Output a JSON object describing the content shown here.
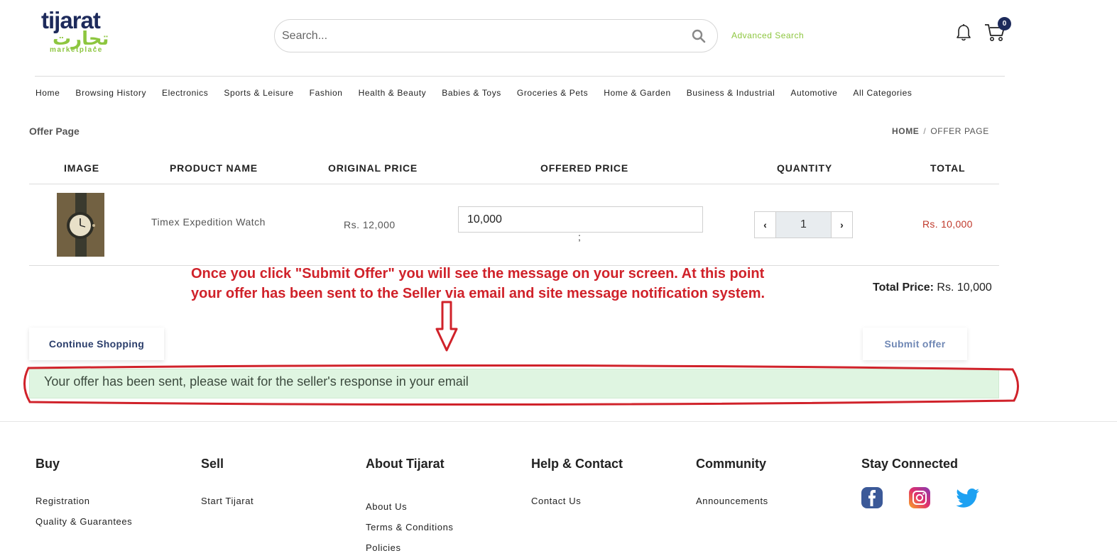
{
  "header": {
    "logo_text_en": "tijarat",
    "logo_text_ar": "تجارت",
    "logo_sub": "marketplace",
    "search_placeholder": "Search...",
    "advanced_search": "Advanced Search",
    "cart_count": "0"
  },
  "nav": [
    "Home",
    "Browsing History",
    "Electronics",
    "Sports & Leisure",
    "Fashion",
    "Health & Beauty",
    "Babies & Toys",
    "Groceries & Pets",
    "Home & Garden",
    "Business & Industrial",
    "Automotive",
    "All Categories"
  ],
  "page": {
    "title": "Offer Page",
    "breadcrumb_home": "HOME",
    "breadcrumb_sep": "/",
    "breadcrumb_current": "OFFER PAGE"
  },
  "table": {
    "headers": [
      "IMAGE",
      "PRODUCT NAME",
      "ORIGINAL PRICE",
      "OFFERED PRICE",
      "QUANTITY",
      "TOTAL"
    ],
    "row": {
      "product_name": "Timex Expedition Watch",
      "original_price": "Rs. 12,000",
      "offered_price": "10,000",
      "stray_char": ";",
      "qty_dec": "‹",
      "quantity": "1",
      "qty_inc": "›",
      "total": "Rs. 10,000"
    }
  },
  "annotation": {
    "line1": "Once you click \"Submit Offer\" you will see the message on your screen. At this point",
    "line2": "your offer has been sent to the Seller via email and site message notification system.",
    "color": "#d0222a"
  },
  "summary": {
    "total_label": "Total Price:",
    "total_value": "Rs. 10,000"
  },
  "buttons": {
    "continue": "Continue Shopping",
    "submit": "Submit offer"
  },
  "alert": {
    "message": "Your offer has been sent, please wait for the seller's response in your email"
  },
  "footer": {
    "buy": {
      "title": "Buy",
      "links": [
        "Registration",
        "Quality & Guarantees"
      ]
    },
    "sell": {
      "title": "Sell",
      "links": [
        "Start Tijarat"
      ]
    },
    "about": {
      "title": "About Tijarat",
      "links": [
        "About Us",
        "Terms & Conditions",
        "Policies"
      ]
    },
    "help": {
      "title": "Help & Contact",
      "links": [
        "Contact Us"
      ]
    },
    "community": {
      "title": "Community",
      "links": [
        "Announcements"
      ]
    },
    "social": {
      "title": "Stay Connected",
      "icons": [
        "facebook-icon",
        "instagram-icon",
        "twitter-icon"
      ]
    }
  },
  "colors": {
    "brand_navy": "#1d2a5b",
    "brand_green": "#8dc63f",
    "price_red": "#c0392b",
    "alert_bg": "#dff5e1"
  }
}
